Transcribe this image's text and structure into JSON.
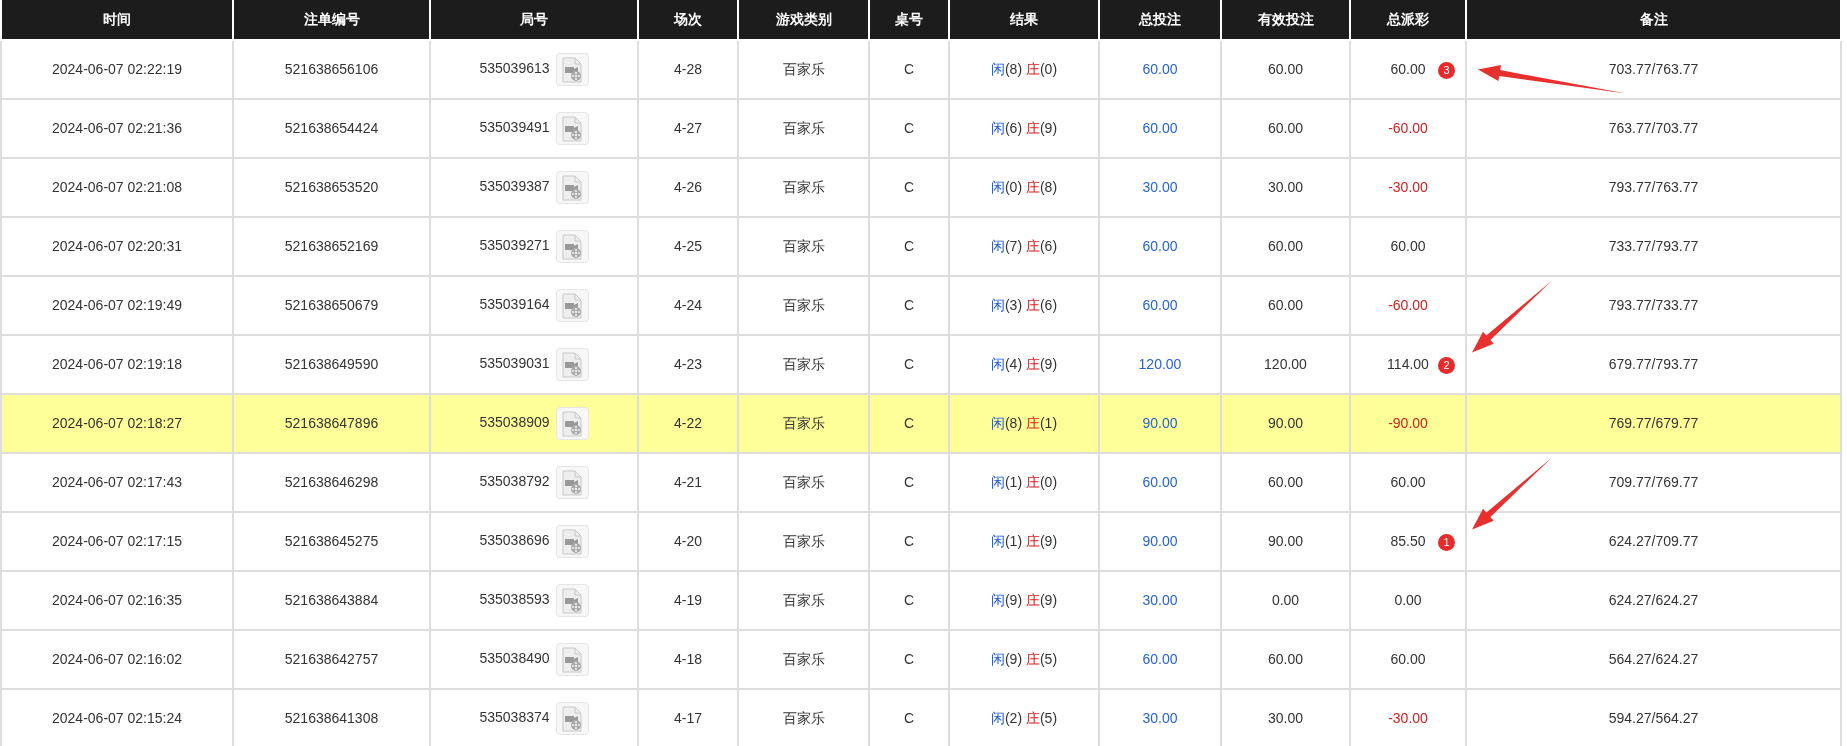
{
  "table": {
    "columns": [
      "时间",
      "注单编号",
      "局号",
      "场次",
      "游戏类别",
      "桌号",
      "结果",
      "总投注",
      "有效投注",
      "总派彩",
      "备注"
    ],
    "rows": [
      {
        "time": "2024-06-07 02:22:19",
        "bet_id": "521638656106",
        "round_id": "535039613",
        "match": "4-28",
        "game": "百家乐",
        "desk": "C",
        "player_label": "闲",
        "player_score": "(8)",
        "banker_label": "庄",
        "banker_score": "(0)",
        "total_bet": "60.00",
        "valid_bet": "60.00",
        "payout": "60.00",
        "loss": false,
        "note": "703.77/763.77",
        "selected": false,
        "annotation": {
          "badge": "3",
          "kind": "shallow"
        }
      },
      {
        "time": "2024-06-07 02:21:36",
        "bet_id": "521638654424",
        "round_id": "535039491",
        "match": "4-27",
        "game": "百家乐",
        "desk": "C",
        "player_label": "闲",
        "player_score": "(6)",
        "banker_label": "庄",
        "banker_score": "(9)",
        "total_bet": "60.00",
        "valid_bet": "60.00",
        "payout": "-60.00",
        "loss": true,
        "note": "763.77/703.77",
        "selected": false
      },
      {
        "time": "2024-06-07 02:21:08",
        "bet_id": "521638653520",
        "round_id": "535039387",
        "match": "4-26",
        "game": "百家乐",
        "desk": "C",
        "player_label": "闲",
        "player_score": "(0)",
        "banker_label": "庄",
        "banker_score": "(8)",
        "total_bet": "30.00",
        "valid_bet": "30.00",
        "payout": "-30.00",
        "loss": true,
        "note": "793.77/763.77",
        "selected": false
      },
      {
        "time": "2024-06-07 02:20:31",
        "bet_id": "521638652169",
        "round_id": "535039271",
        "match": "4-25",
        "game": "百家乐",
        "desk": "C",
        "player_label": "闲",
        "player_score": "(7)",
        "banker_label": "庄",
        "banker_score": "(6)",
        "total_bet": "60.00",
        "valid_bet": "60.00",
        "payout": "60.00",
        "loss": false,
        "note": "733.77/793.77",
        "selected": false
      },
      {
        "time": "2024-06-07 02:19:49",
        "bet_id": "521638650679",
        "round_id": "535039164",
        "match": "4-24",
        "game": "百家乐",
        "desk": "C",
        "player_label": "闲",
        "player_score": "(3)",
        "banker_label": "庄",
        "banker_score": "(6)",
        "total_bet": "60.00",
        "valid_bet": "60.00",
        "payout": "-60.00",
        "loss": true,
        "note": "793.77/733.77",
        "selected": false
      },
      {
        "time": "2024-06-07 02:19:18",
        "bet_id": "521638649590",
        "round_id": "535039031",
        "match": "4-23",
        "game": "百家乐",
        "desk": "C",
        "player_label": "闲",
        "player_score": "(4)",
        "banker_label": "庄",
        "banker_score": "(9)",
        "total_bet": "120.00",
        "valid_bet": "120.00",
        "payout": "114.00",
        "loss": false,
        "note": "679.77/793.77",
        "selected": false,
        "annotation": {
          "badge": "2",
          "kind": "steep"
        }
      },
      {
        "time": "2024-06-07 02:18:27",
        "bet_id": "521638647896",
        "round_id": "535038909",
        "match": "4-22",
        "game": "百家乐",
        "desk": "C",
        "player_label": "闲",
        "player_score": "(8)",
        "banker_label": "庄",
        "banker_score": "(1)",
        "total_bet": "90.00",
        "valid_bet": "90.00",
        "payout": "-90.00",
        "loss": true,
        "note": "769.77/679.77",
        "selected": true
      },
      {
        "time": "2024-06-07 02:17:43",
        "bet_id": "521638646298",
        "round_id": "535038792",
        "match": "4-21",
        "game": "百家乐",
        "desk": "C",
        "player_label": "闲",
        "player_score": "(1)",
        "banker_label": "庄",
        "banker_score": "(0)",
        "total_bet": "60.00",
        "valid_bet": "60.00",
        "payout": "60.00",
        "loss": false,
        "note": "709.77/769.77",
        "selected": false
      },
      {
        "time": "2024-06-07 02:17:15",
        "bet_id": "521638645275",
        "round_id": "535038696",
        "match": "4-20",
        "game": "百家乐",
        "desk": "C",
        "player_label": "闲",
        "player_score": "(1)",
        "banker_label": "庄",
        "banker_score": "(9)",
        "total_bet": "90.00",
        "valid_bet": "90.00",
        "payout": "85.50",
        "loss": false,
        "note": "624.27/709.77",
        "selected": false,
        "annotation": {
          "badge": "1",
          "kind": "steep"
        }
      },
      {
        "time": "2024-06-07 02:16:35",
        "bet_id": "521638643884",
        "round_id": "535038593",
        "match": "4-19",
        "game": "百家乐",
        "desk": "C",
        "player_label": "闲",
        "player_score": "(9)",
        "banker_label": "庄",
        "banker_score": "(9)",
        "total_bet": "30.00",
        "valid_bet": "0.00",
        "payout": "0.00",
        "loss": false,
        "note": "624.27/624.27",
        "selected": false
      },
      {
        "time": "2024-06-07 02:16:02",
        "bet_id": "521638642757",
        "round_id": "535038490",
        "match": "4-18",
        "game": "百家乐",
        "desk": "C",
        "player_label": "闲",
        "player_score": "(9)",
        "banker_label": "庄",
        "banker_score": "(5)",
        "total_bet": "60.00",
        "valid_bet": "60.00",
        "payout": "60.00",
        "loss": false,
        "note": "564.27/624.27",
        "selected": false
      },
      {
        "time": "2024-06-07 02:15:24",
        "bet_id": "521638641308",
        "round_id": "535038374",
        "match": "4-17",
        "game": "百家乐",
        "desk": "C",
        "player_label": "闲",
        "player_score": "(2)",
        "banker_label": "庄",
        "banker_score": "(5)",
        "total_bet": "30.00",
        "valid_bet": "30.00",
        "payout": "-30.00",
        "loss": true,
        "note": "594.27/564.27",
        "selected": false
      }
    ]
  }
}
